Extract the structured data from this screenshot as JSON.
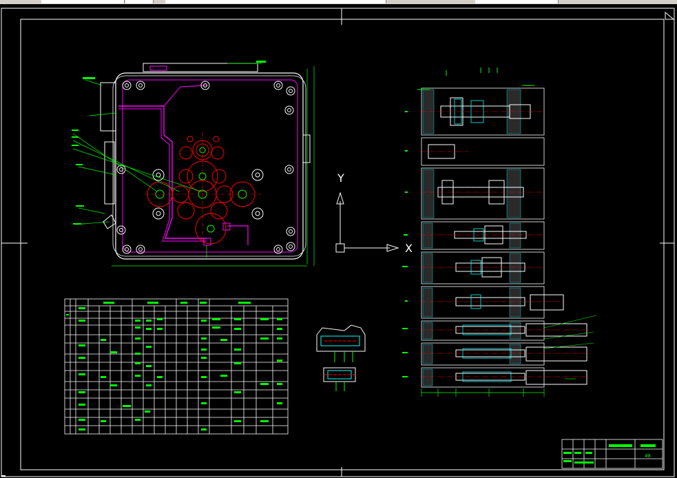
{
  "colors": {
    "background": "#000000",
    "frame": "#ffffff",
    "green": "#00ff00",
    "red": "#ff0000",
    "magenta": "#ff00ff",
    "cyan": "#00ffff",
    "yellow": "#ffff00"
  },
  "ucs": {
    "y_label": "Y",
    "x_label": "X"
  },
  "title_block": {
    "label": "40"
  }
}
